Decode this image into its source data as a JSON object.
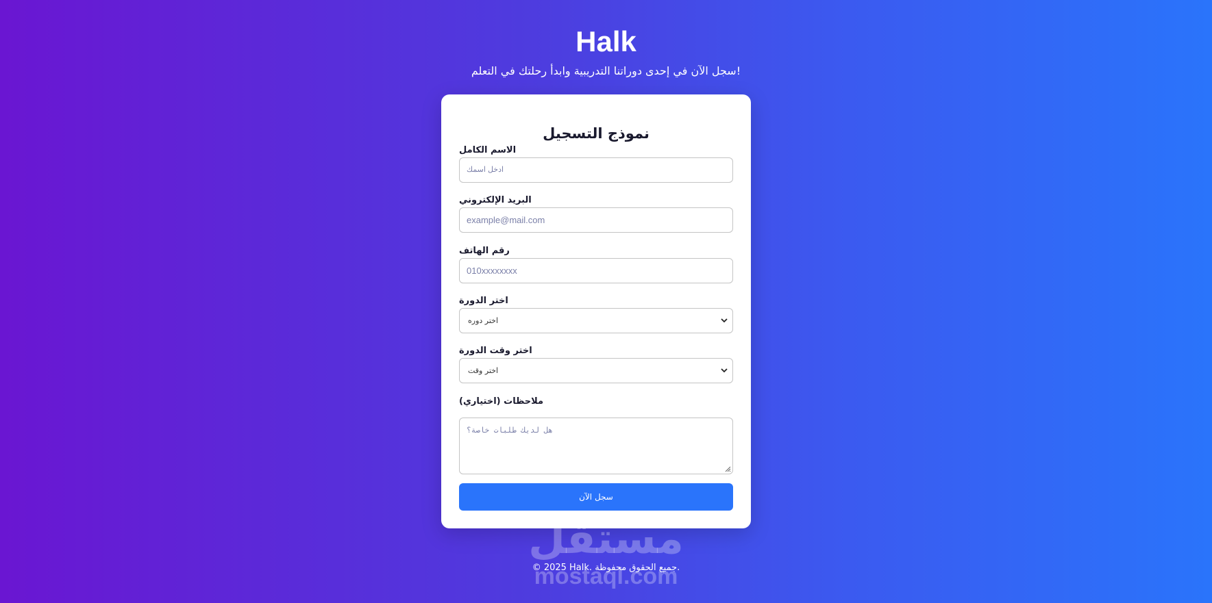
{
  "header": {
    "brand": "Halk",
    "tagline": "!سجل الآن في إحدى دوراتنا التدريبية وابدأ رحلتك في التعلم"
  },
  "form": {
    "title": "نموذج التسجيل",
    "full_name": {
      "label": "الاسم الكامل",
      "placeholder": "ادخل اسمك"
    },
    "email": {
      "label": "البريد الإلكتروني",
      "placeholder": "example@mail.com"
    },
    "phone": {
      "label": "رقم الهاتف",
      "placeholder": "010xxxxxxxx"
    },
    "course": {
      "label": "اختر الدورة",
      "selected": "اختر دوره"
    },
    "course_time": {
      "label": "اختر وقت الدورة",
      "selected": "اختر وقت"
    },
    "notes": {
      "label": "ملاحظات (اختياري)",
      "placeholder": "هل لديك طلبات خاصة؟"
    },
    "submit_label": "سجل الآن"
  },
  "watermark": {
    "arabic": "مستقل",
    "latin": "mostaql.com"
  },
  "footer": {
    "copyright": "© 2025 Halk. جميع الحقوق محفوظة."
  }
}
